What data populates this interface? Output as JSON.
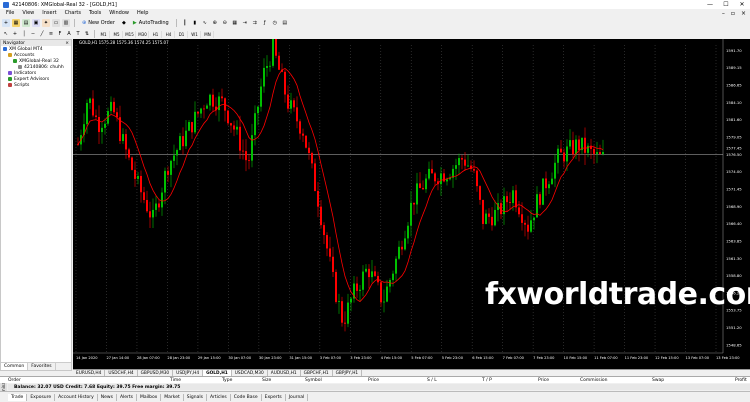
{
  "window": {
    "title": "42140806: XMGlobal-Real 32 - [GOLD,H1]"
  },
  "menu": [
    "File",
    "View",
    "Insert",
    "Charts",
    "Tools",
    "Window",
    "Help"
  ],
  "toolbar": {
    "new_order": "New Order",
    "autotrading": "AutoTrading"
  },
  "timeframes": [
    "M1",
    "M5",
    "M15",
    "M30",
    "H1",
    "H4",
    "D1",
    "W1",
    "MN"
  ],
  "navigator": {
    "title": "Navigator",
    "items": [
      {
        "label": "XM Global MT4",
        "level": 0
      },
      {
        "label": "Accounts",
        "level": 1
      },
      {
        "label": "XMGlobal-Real 32",
        "level": 2
      },
      {
        "label": "42140806: chuhh",
        "level": 3
      },
      {
        "label": "Indicators",
        "level": 1
      },
      {
        "label": "Expert Advisors",
        "level": 1
      },
      {
        "label": "Scripts",
        "level": 1
      }
    ],
    "tabs": [
      "Common",
      "Favorites"
    ]
  },
  "chart": {
    "header": "GOLD,H1  1575.28 1575.36 1574.25 1575.07",
    "price_labels": [
      "1591.70",
      "1589.15",
      "1586.65",
      "1584.10",
      "1581.60",
      "1579.05",
      "1577.45",
      "1576.50",
      "1574.00",
      "1571.45",
      "1568.90",
      "1566.40",
      "1563.85",
      "1561.30",
      "1558.80",
      "1556.25",
      "1553.75",
      "1551.20",
      "1548.65"
    ],
    "time_labels": [
      "14 Jan 2020",
      "27 Jan 14:00",
      "28 Jan 07:00",
      "28 Jan 23:00",
      "29 Jan 15:00",
      "30 Jan 07:00",
      "30 Jan 23:00",
      "31 Jan 15:00",
      "3 Feb 07:00",
      "3 Feb 23:00",
      "4 Feb 15:00",
      "5 Feb 07:00",
      "5 Feb 23:00",
      "6 Feb 15:00",
      "7 Feb 07:00",
      "7 Feb 23:00",
      "10 Feb 15:00",
      "11 Feb 07:00",
      "11 Feb 23:00",
      "12 Feb 15:00",
      "13 Feb 07:00",
      "13 Feb 23:00"
    ],
    "watermark": "fxworldtrade.com",
    "bull_color": "#00c000",
    "bear_color": "#ff0000",
    "ma_color": "#ff0000",
    "current_price_line": "1576.50"
  },
  "chart_tabs": [
    "EURUSD,H4",
    "USDCHF,H4",
    "GBPUSD,M30",
    "USDJPY,H4",
    "GOLD,H1",
    "USDCAD,M30",
    "AUDUSD,H1",
    "GBPCHF,H1",
    "GBPJPY,H1"
  ],
  "terminal": {
    "columns": [
      "Order",
      "Time",
      "Type",
      "Size",
      "Symbol",
      "Price",
      "S / L",
      "T / P",
      "Price",
      "Commission",
      "Swap",
      "Profit"
    ],
    "balance_line": "Balance: 32.07 USD  Credit: 7.68  Equity: 39.75  Free margin: 39.75",
    "tabs": [
      "Trade",
      "Exposure",
      "Account History",
      "News",
      "Alerts",
      "Mailbox",
      "Market",
      "Signals",
      "Articles",
      "Code Base",
      "Experts",
      "Journal"
    ],
    "side_label": "Terminal"
  }
}
